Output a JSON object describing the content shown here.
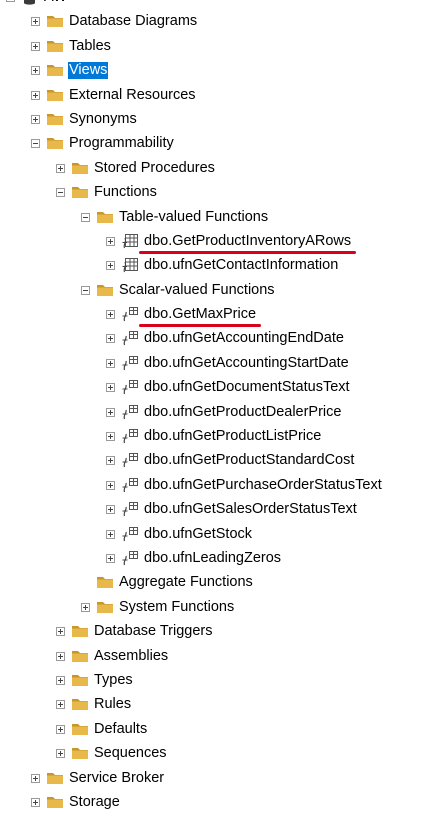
{
  "tree": {
    "nodes": [
      {
        "label": "AW",
        "icon": "database-icon",
        "level": 0,
        "expander": "expanded"
      },
      {
        "label": "Database Diagrams",
        "icon": "folder-icon",
        "level": 1,
        "expander": "collapsed"
      },
      {
        "label": "Tables",
        "icon": "folder-icon",
        "level": 1,
        "expander": "collapsed"
      },
      {
        "label": "Views",
        "icon": "folder-icon",
        "level": 1,
        "expander": "collapsed",
        "selected": true
      },
      {
        "label": "External Resources",
        "icon": "folder-icon",
        "level": 1,
        "expander": "collapsed"
      },
      {
        "label": "Synonyms",
        "icon": "folder-icon",
        "level": 1,
        "expander": "collapsed"
      },
      {
        "label": "Programmability",
        "icon": "folder-icon",
        "level": 1,
        "expander": "expanded"
      },
      {
        "label": "Stored Procedures",
        "icon": "folder-icon",
        "level": 2,
        "expander": "collapsed"
      },
      {
        "label": "Functions",
        "icon": "folder-icon",
        "level": 2,
        "expander": "expanded"
      },
      {
        "label": "Table-valued Functions",
        "icon": "folder-icon",
        "level": 3,
        "expander": "expanded"
      },
      {
        "label": "dbo.GetProductInventoryARows",
        "icon": "table-valued-function-icon",
        "level": 4,
        "expander": "collapsed",
        "annotated": true
      },
      {
        "label": "dbo.ufnGetContactInformation",
        "icon": "table-valued-function-icon",
        "level": 4,
        "expander": "collapsed"
      },
      {
        "label": "Scalar-valued Functions",
        "icon": "folder-icon",
        "level": 3,
        "expander": "expanded"
      },
      {
        "label": "dbo.GetMaxPrice",
        "icon": "scalar-function-icon",
        "level": 4,
        "expander": "collapsed",
        "annotated": true
      },
      {
        "label": "dbo.ufnGetAccountingEndDate",
        "icon": "scalar-function-icon",
        "level": 4,
        "expander": "collapsed"
      },
      {
        "label": "dbo.ufnGetAccountingStartDate",
        "icon": "scalar-function-icon",
        "level": 4,
        "expander": "collapsed"
      },
      {
        "label": "dbo.ufnGetDocumentStatusText",
        "icon": "scalar-function-icon",
        "level": 4,
        "expander": "collapsed"
      },
      {
        "label": "dbo.ufnGetProductDealerPrice",
        "icon": "scalar-function-icon",
        "level": 4,
        "expander": "collapsed"
      },
      {
        "label": "dbo.ufnGetProductListPrice",
        "icon": "scalar-function-icon",
        "level": 4,
        "expander": "collapsed"
      },
      {
        "label": "dbo.ufnGetProductStandardCost",
        "icon": "scalar-function-icon",
        "level": 4,
        "expander": "collapsed"
      },
      {
        "label": "dbo.ufnGetPurchaseOrderStatusText",
        "icon": "scalar-function-icon",
        "level": 4,
        "expander": "collapsed"
      },
      {
        "label": "dbo.ufnGetSalesOrderStatusText",
        "icon": "scalar-function-icon",
        "level": 4,
        "expander": "collapsed"
      },
      {
        "label": "dbo.ufnGetStock",
        "icon": "scalar-function-icon",
        "level": 4,
        "expander": "collapsed"
      },
      {
        "label": "dbo.ufnLeadingZeros",
        "icon": "scalar-function-icon",
        "level": 4,
        "expander": "collapsed"
      },
      {
        "label": "Aggregate Functions",
        "icon": "folder-icon",
        "level": 3,
        "expander": "none"
      },
      {
        "label": "System Functions",
        "icon": "folder-icon",
        "level": 3,
        "expander": "collapsed"
      },
      {
        "label": "Database Triggers",
        "icon": "folder-icon",
        "level": 2,
        "expander": "collapsed"
      },
      {
        "label": "Assemblies",
        "icon": "folder-icon",
        "level": 2,
        "expander": "collapsed"
      },
      {
        "label": "Types",
        "icon": "folder-icon",
        "level": 2,
        "expander": "collapsed"
      },
      {
        "label": "Rules",
        "icon": "folder-icon",
        "level": 2,
        "expander": "collapsed"
      },
      {
        "label": "Defaults",
        "icon": "folder-icon",
        "level": 2,
        "expander": "collapsed"
      },
      {
        "label": "Sequences",
        "icon": "folder-icon",
        "level": 2,
        "expander": "collapsed"
      },
      {
        "label": "Service Broker",
        "icon": "folder-icon",
        "level": 1,
        "expander": "collapsed"
      },
      {
        "label": "Storage",
        "icon": "folder-icon",
        "level": 1,
        "expander": "collapsed"
      }
    ]
  },
  "colors": {
    "folder": "#e8b84a",
    "folder_dark": "#c9962a",
    "selection": "#0078d7",
    "annotation": "#d9001b",
    "database": "#3a3a3a"
  }
}
